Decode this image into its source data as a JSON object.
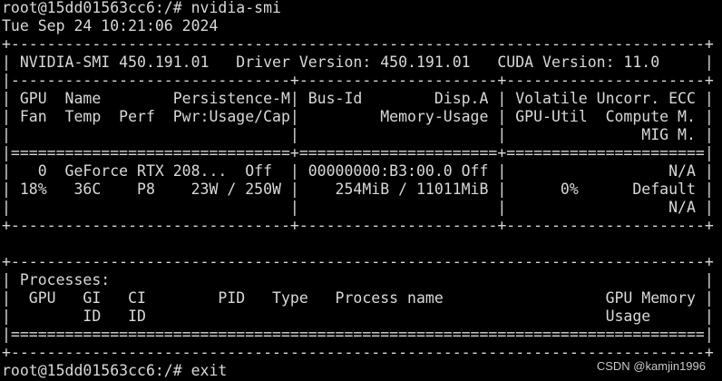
{
  "terminal": {
    "foreground": "#d8d8d8",
    "background": "#000000",
    "lines": [
      "root@15dd01563cc6:/# nvidia-smi",
      "Tue Sep 24 10:21:06 2024",
      "+-----------------------------------------------------------------------------+",
      "| NVIDIA-SMI 450.191.01   Driver Version: 450.191.01   CUDA Version: 11.0     |",
      "|-------------------------------+----------------------+----------------------+",
      "| GPU  Name        Persistence-M| Bus-Id        Disp.A | Volatile Uncorr. ECC |",
      "| Fan  Temp  Perf  Pwr:Usage/Cap|         Memory-Usage | GPU-Util  Compute M. |",
      "|                               |                      |               MIG M. |",
      "|===============================+======================+======================|",
      "|   0  GeForce RTX 208...  Off  | 00000000:B3:00.0 Off |                  N/A |",
      "| 18%   36C    P8    23W / 250W |    254MiB / 11011MiB |      0%      Default |",
      "|                               |                      |                  N/A |",
      "+-------------------------------+----------------------+----------------------+",
      "",
      "+-----------------------------------------------------------------------------+",
      "| Processes:                                                                  |",
      "|  GPU   GI   CI        PID   Type   Process name                  GPU Memory |",
      "|        ID   ID                                                   Usage      |",
      "|=============================================================================|",
      "+-----------------------------------------------------------------------------+",
      "root@15dd01563cc6:/# exit"
    ]
  },
  "watermark": "CSDN @kamjin1996"
}
